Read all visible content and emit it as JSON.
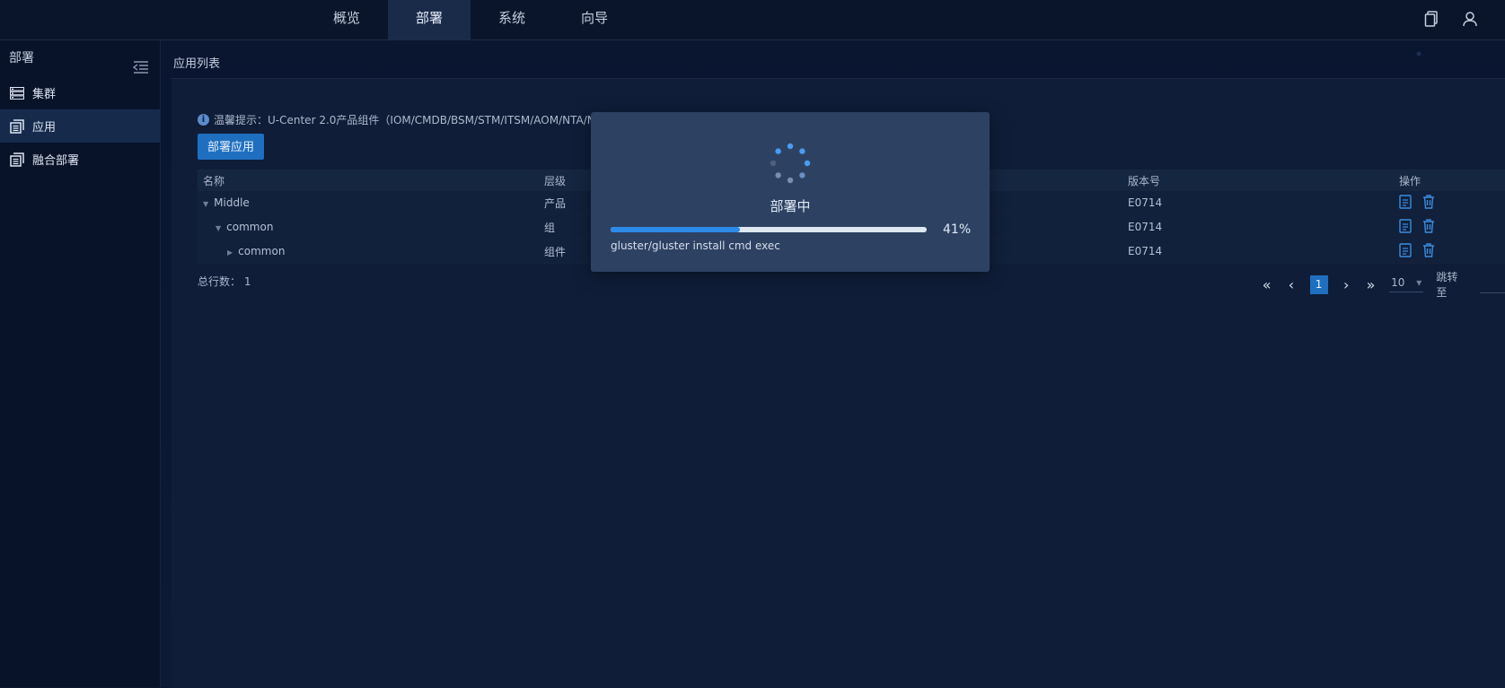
{
  "nav": {
    "items": [
      "概览",
      "部署",
      "系统",
      "向导"
    ],
    "active_index": 1
  },
  "top_icons": [
    "document-icon",
    "user-icon"
  ],
  "sidebar": {
    "title": "部署",
    "items": [
      {
        "label": "集群",
        "icon": "server-icon",
        "active": false
      },
      {
        "label": "应用",
        "icon": "app-list-icon",
        "active": true
      },
      {
        "label": "融合部署",
        "icon": "app-list-icon",
        "active": false
      }
    ]
  },
  "breadcrumb": "应用列表",
  "tip": "温馨提示：U-Center 2.0产品组件（IOM/CMDB/BSM/STM/ITSM/AOM/NTA/NSM",
  "deploy_button": "部署应用",
  "table": {
    "headers": [
      "名称",
      "层级",
      "版本号",
      "操作"
    ],
    "rows": [
      {
        "name": "Middle",
        "level": "产品",
        "version": "E0714",
        "indent": 0,
        "expanded": true
      },
      {
        "name": "common",
        "level": "组",
        "version": "E0714",
        "indent": 1,
        "expanded": true
      },
      {
        "name": "common",
        "level": "组件",
        "version": "E0714",
        "indent": 2,
        "expanded": false
      }
    ]
  },
  "total": {
    "label": "总行数：",
    "value": "1"
  },
  "pager": {
    "current": "1",
    "page_size": "10",
    "jump_label": "跳转至"
  },
  "modal": {
    "title": "部署中",
    "progress": 0.41,
    "percent_text": "41%",
    "message": "gluster/gluster install cmd exec"
  },
  "colors": {
    "accent": "#1f6fc0",
    "progress": "#2c8ae8",
    "modal_bg": "#2d4263"
  }
}
